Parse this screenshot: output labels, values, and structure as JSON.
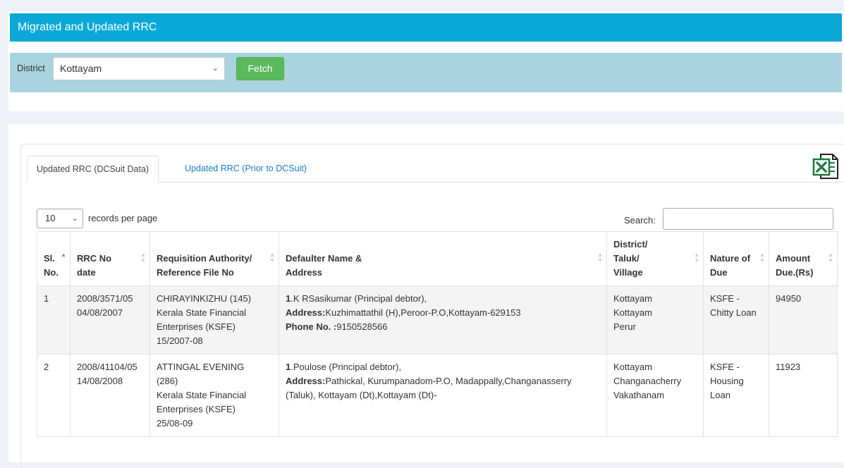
{
  "header": {
    "title": "Migrated and Updated RRC"
  },
  "filter": {
    "label": "District",
    "selected": "Kottayam",
    "fetch_label": "Fetch"
  },
  "tabs": [
    {
      "label": "Updated RRC (DCSuit Data)",
      "active": true
    },
    {
      "label": "Updated RRC (Prior to DCSuit)",
      "active": false
    }
  ],
  "export": {
    "icon": "excel-export-icon"
  },
  "table_controls": {
    "page_length": "10",
    "page_length_label": "records per page",
    "search_label": "Search:"
  },
  "columns": [
    {
      "l1": "Sl.",
      "l2": "No."
    },
    {
      "l1": "RRC No",
      "l2": "date"
    },
    {
      "l1": "Requisition Authority/",
      "l2": "Reference File No"
    },
    {
      "l1": "Defaulter Name &",
      "l2": "Address"
    },
    {
      "l1": "District/",
      "l2": "Taluk/",
      "l3": "Village"
    },
    {
      "l1": "Nature of",
      "l2": "Due"
    },
    {
      "l1": "Amount",
      "l2": "Due.(Rs)"
    }
  ],
  "rows": [
    {
      "sl": "1",
      "rrc_no": "2008/3571/05",
      "rrc_date": "04/08/2007",
      "authority": [
        "CHIRAYINKIZHU (145)",
        "Kerala State Financial",
        "Enterprises (KSFE)",
        "15/2007-08"
      ],
      "defaulter_num": "1",
      "defaulter_name": ".K RSasikumar (Principal debtor),",
      "address_label": "Address:",
      "address": "Kuzhimattathil (H),Peroor-P.O,Kottayam-629153",
      "phone_label": "Phone No. :",
      "phone": "9150528566",
      "location": [
        "Kottayam",
        "Kottayam",
        "Perur"
      ],
      "nature": [
        "KSFE -",
        "Chitty Loan"
      ],
      "amount": "94950"
    },
    {
      "sl": "2",
      "rrc_no": "2008/41104/05",
      "rrc_date": "14/08/2008",
      "authority": [
        "ATTINGAL EVENING",
        "(286)",
        "Kerala State Financial",
        "Enterprises (KSFE)",
        "25/08-09"
      ],
      "defaulter_num": "1",
      "defaulter_name": ".Poulose (Principal debtor),",
      "address_label": "Address:",
      "address": "Pathickal, Kurumpanadom-P.O, Madappally,Changanasserry (Taluk), Kottayam (Dt),Kottayam (Dt)-",
      "phone_label": "",
      "phone": "",
      "location": [
        "Kottayam",
        "Changanacherry",
        "Vakathanam"
      ],
      "nature": [
        "KSFE -",
        "Housing",
        "Loan"
      ],
      "amount": "11923"
    }
  ]
}
